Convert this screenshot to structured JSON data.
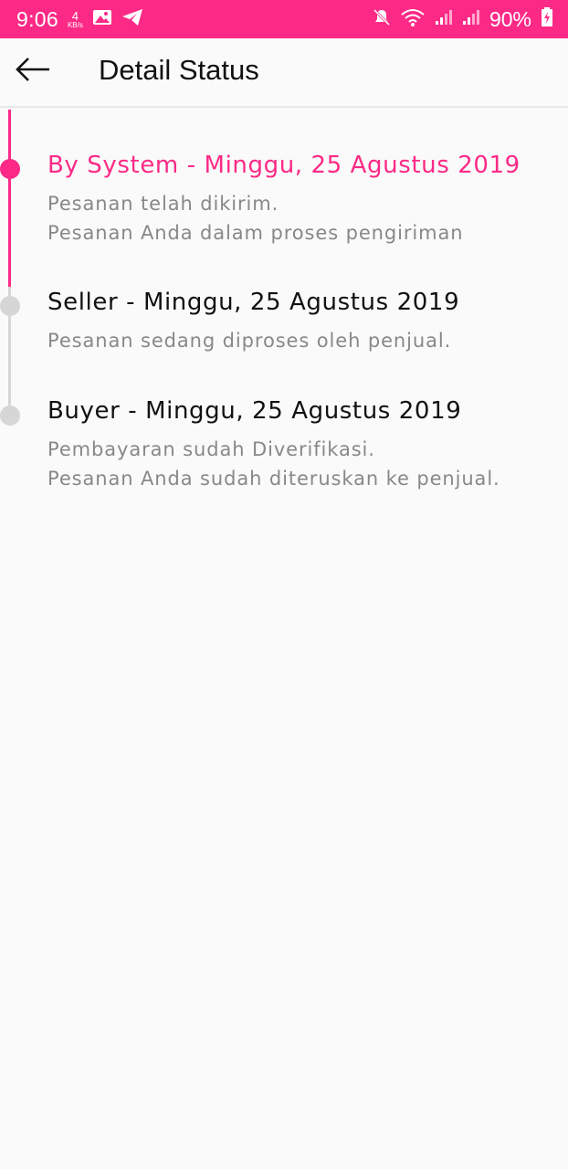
{
  "status_bar": {
    "time": "9:06",
    "net_speed_value": "4",
    "net_speed_unit": "KB/s",
    "battery": "90%"
  },
  "app_bar": {
    "title": "Detail Status",
    "back_icon": "arrow-left-icon"
  },
  "colors": {
    "accent": "#fc2a86",
    "inactive": "#d6d6d6",
    "description": "#888888"
  },
  "timeline": [
    {
      "title": "By System - Minggu, 25 Agustus 2019",
      "lines": [
        "Pesanan telah dikirim.",
        "Pesanan Anda dalam proses pengiriman"
      ],
      "active": true
    },
    {
      "title": "Seller - Minggu, 25 Agustus 2019",
      "lines": [
        "Pesanan sedang diproses oleh penjual."
      ],
      "active": false
    },
    {
      "title": "Buyer - Minggu, 25 Agustus 2019",
      "lines": [
        "Pembayaran sudah Diverifikasi.",
        "Pesanan Anda sudah diteruskan ke penjual."
      ],
      "active": false
    }
  ]
}
